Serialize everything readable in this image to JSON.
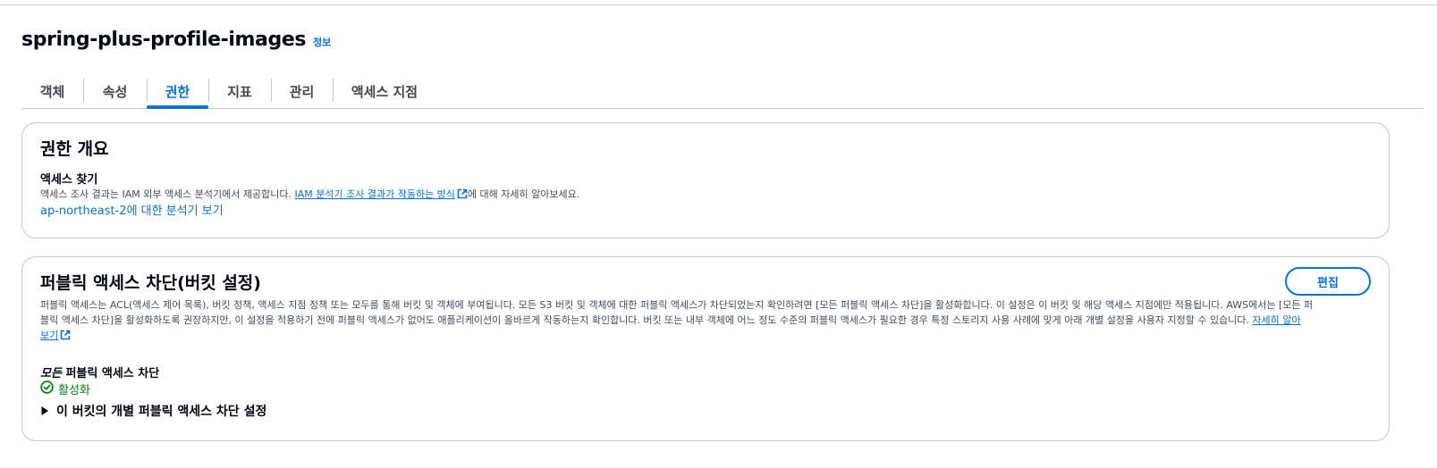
{
  "header": {
    "title": "spring-plus-profile-images",
    "info_link": "정보"
  },
  "tabs": [
    {
      "label": "객체",
      "active": false
    },
    {
      "label": "속성",
      "active": false
    },
    {
      "label": "권한",
      "active": true
    },
    {
      "label": "지표",
      "active": false
    },
    {
      "label": "관리",
      "active": false
    },
    {
      "label": "액세스 지점",
      "active": false
    }
  ],
  "overview": {
    "title": "권한 개요",
    "access_finder_title": "액세스 찾기",
    "desc_before": "액세스 조사 결과는 IAM 외부 액세스 분석기에서 제공합니다. ",
    "desc_link": "IAM 분석기 조사 결과가 작동하는 방식",
    "desc_after": "에 대해 자세히 알아보세요.",
    "analyzer_link": "ap-northeast-2에 대한 분석기 보기"
  },
  "block_public_access": {
    "title": "퍼블릭 액세스 차단(버킷 설정)",
    "edit_label": "편집",
    "desc_line1": "퍼블릭 액세스는 ACL(액세스 제어 목록), 버킷 정책, 액세스 지점 정책 또는 모두를 통해 버킷 및 객체에 부여됩니다. 모든 S3 버킷 및 객체에 대한 퍼블릭 액세스가 차단되었는지 확인하려면 [모든 퍼블릭 액세스 차단]을 활성화합니다. 이 설정은 이 버킷 및 해당 액세스 지점에만 적용됩니다. AWS에서는 [모든 퍼",
    "desc_line2": "블릭 액세스 차단]을 활성화하도록 권장하지만, 이 설정을 적용하기 전에 퍼블릭 액세스가 없어도 애플리케이션이 올바르게 작동하는지 확인합니다. 버킷 또는 내부 객체에 어느 정도 수준의 퍼블릭 액세스가 필요한 경우 특정 스토리지 사용 사례에 맞게 아래 개별 설정을 사용자 지정할 수 있습니다. ",
    "learn_more_part1": "자세히 알아",
    "learn_more_part2": "보기",
    "block_all_em": "모든",
    "block_all_rest": " 퍼블릭 액세스 차단",
    "status": "활성화",
    "status_color": "#037f0c",
    "expander_label": "이 버킷의 개별 퍼블릭 액세스 차단 설정"
  },
  "colors": {
    "accent": "#0972d3",
    "success": "#037f0c",
    "border": "#c6c6cd"
  },
  "icons": [
    "external-link-icon",
    "check-circle-icon",
    "caret-right-icon"
  ]
}
